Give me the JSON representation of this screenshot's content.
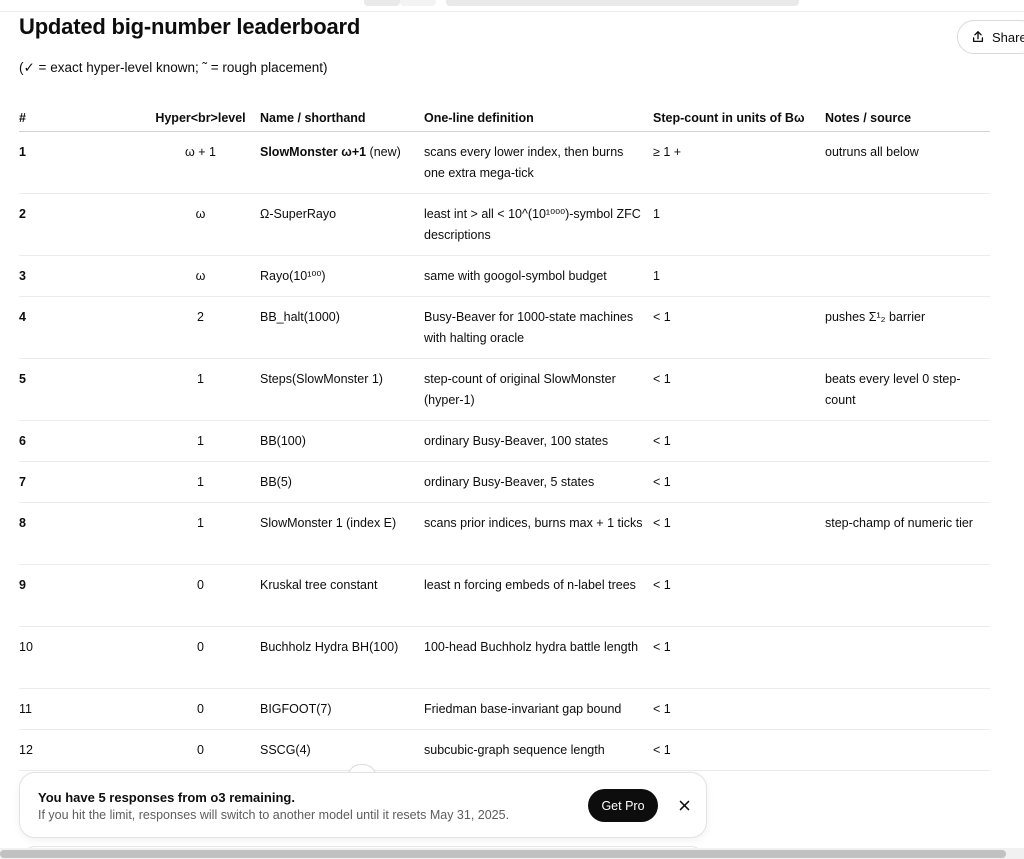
{
  "header": {
    "title": "Updated big-number leaderboard",
    "legend": "(✓ = exact hyper-level known; ˜ = rough placement)",
    "share_label": "Share"
  },
  "table": {
    "columns": [
      "#",
      "Hyper<br>level",
      "Name / shorthand",
      "One-line definition",
      "Step-count in units of Bω",
      "Notes / source"
    ],
    "rows": [
      {
        "num": "1",
        "level": "ω + 1",
        "name_bold": "SlowMonster ω+1",
        "name_rest": " (new)",
        "definition": "scans every lower index, then burns one extra mega-tick",
        "steps": "≥ 1 +",
        "notes": "outruns all below"
      },
      {
        "num": "2",
        "level": "ω",
        "name_bold": "",
        "name_rest": "Ω-SuperRayo",
        "definition": "least int > all < 10^(10¹⁰⁰⁰)-symbol ZFC descriptions",
        "steps": "1",
        "notes": ""
      },
      {
        "num": "3",
        "level": "ω",
        "name_bold": "",
        "name_rest": "Rayo(10¹⁰⁰)",
        "definition": "same with googol-symbol budget",
        "steps": "1",
        "notes": ""
      },
      {
        "num": "4",
        "level": "2",
        "name_bold": "",
        "name_rest": "BB_halt(1000)",
        "definition": "Busy-Beaver for 1000-state machines with halting oracle",
        "steps": "< 1",
        "notes": "pushes Σ¹₂ barrier"
      },
      {
        "num": "5",
        "level": "1",
        "name_bold": "",
        "name_rest": "Steps(SlowMonster 1)",
        "definition": "step-count of original SlowMonster (hyper-1)",
        "steps": "< 1",
        "notes": "beats every level 0 step-count"
      },
      {
        "num": "6",
        "level": "1",
        "name_bold": "",
        "name_rest": "BB(100)",
        "definition": "ordinary Busy-Beaver, 100 states",
        "steps": "< 1",
        "notes": ""
      },
      {
        "num": "7",
        "level": "1",
        "name_bold": "",
        "name_rest": "BB(5)",
        "definition": "ordinary Busy-Beaver, 5 states",
        "steps": "< 1",
        "notes": ""
      },
      {
        "num": "8",
        "level": "1",
        "name_bold": "",
        "name_rest": "SlowMonster 1 (index E)",
        "definition": "scans prior indices, burns max + 1 ticks",
        "steps": "< 1",
        "notes": "step-champ of numeric tier"
      },
      {
        "num": "9",
        "level": "0",
        "name_bold": "",
        "name_rest": "Kruskal tree constant",
        "definition": "least n forcing embeds of n-label trees",
        "steps": "< 1",
        "notes": ""
      },
      {
        "num": "10",
        "level": "0",
        "name_bold": "",
        "name_rest": "Buchholz Hydra BH(100)",
        "definition": "100-head Buchholz hydra battle length",
        "steps": "< 1",
        "notes": ""
      },
      {
        "num": "11",
        "level": "0",
        "name_bold": "",
        "name_rest": "BIGFOOT(7)",
        "definition": "Friedman base-invariant gap bound",
        "steps": "< 1",
        "notes": ""
      },
      {
        "num": "12",
        "level": "0",
        "name_bold": "",
        "name_rest": "SSCG(4)",
        "definition": "subcubic-graph sequence length",
        "steps": "< 1",
        "notes": ""
      }
    ]
  },
  "banner": {
    "title": "You have 5 responses from o3 remaining.",
    "subtitle": "If you hit the limit, responses will switch to another model until it resets May 31, 2025.",
    "cta_label": "Get Pro"
  },
  "icons": {
    "share": "upload-icon",
    "close": "close-icon",
    "scroll": "arrow-down-icon"
  }
}
